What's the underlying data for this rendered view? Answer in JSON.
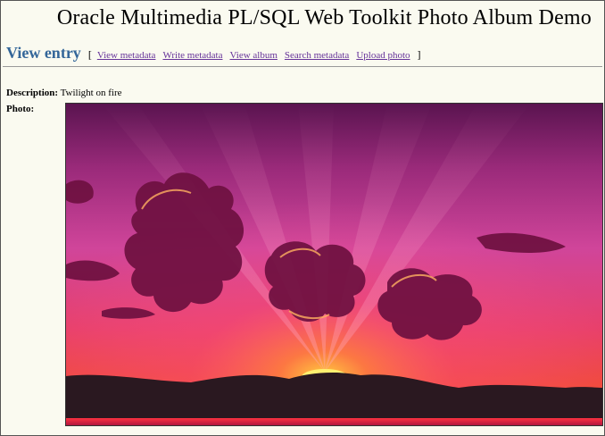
{
  "header": {
    "title": "Oracle Multimedia PL/SQL Web Toolkit Photo Album Demo"
  },
  "nav": {
    "heading": "View entry",
    "open_bracket": "[",
    "close_bracket": "]",
    "links": [
      {
        "label": "View metadata"
      },
      {
        "label": "Write metadata"
      },
      {
        "label": "View album"
      },
      {
        "label": "Search metadata"
      },
      {
        "label": "Upload photo"
      }
    ]
  },
  "entry": {
    "description_label": "Description:",
    "description_value": "Twilight on fire",
    "photo_label": "Photo:",
    "photo_icon": "sunset-photo"
  },
  "colors": {
    "heading": "#336699",
    "link": "#663399",
    "background": "#fafaf0"
  }
}
